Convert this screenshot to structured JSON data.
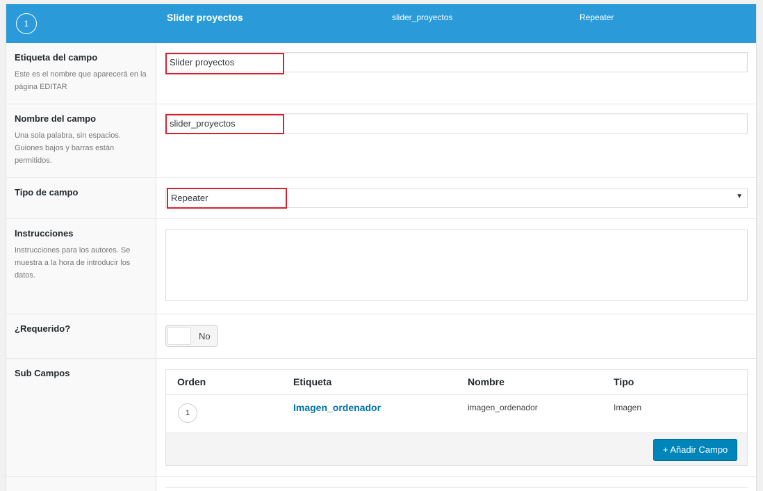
{
  "header": {
    "order": "1",
    "label": "Slider proyectos",
    "name": "slider_proyectos",
    "type": "Repeater"
  },
  "rows": {
    "label": {
      "title": "Etiqueta del campo",
      "desc": "Este es el nombre que aparecerá en la página EDITAR",
      "value": "Slider proyectos"
    },
    "name": {
      "title": "Nombre del campo",
      "desc": "Una sola palabra, sin espacios. Guiones bajos y barras están permitidos.",
      "value": "slider_proyectos"
    },
    "type": {
      "title": "Tipo de campo",
      "selected": "Repeater"
    },
    "instructions": {
      "title": "Instrucciones",
      "desc": "Instrucciones para los autores. Se muestra a la hora de introducir los datos.",
      "value": ""
    },
    "required": {
      "title": "¿Requerido?",
      "toggle_text": "No",
      "checked": false
    },
    "subfields": {
      "title": "Sub Campos",
      "columns": [
        "Orden",
        "Etiqueta",
        "Nombre",
        "Tipo"
      ],
      "rows": [
        {
          "order": "1",
          "label": "Imagen_ordenador",
          "name": "imagen_ordenador",
          "type": "Imagen"
        }
      ],
      "add_button": "+ Añadir Campo"
    }
  },
  "colors": {
    "header_bg": "#2a9bd8",
    "highlight": "#d9202f",
    "primary_button": "#0085ba",
    "link": "#0073aa"
  }
}
